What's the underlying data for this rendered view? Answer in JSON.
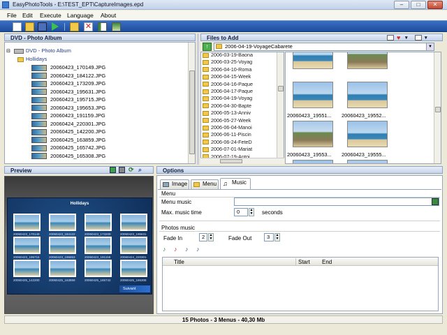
{
  "window": {
    "title": "EasyPhotoTools - E:\\TEST_EPT\\CaptureImages.epd",
    "min": "–",
    "max": "□",
    "close": "✕"
  },
  "menu": [
    "File",
    "Edit",
    "Execute",
    "Language",
    "About"
  ],
  "toolbar": {
    "icons": [
      "new-icon",
      "open-icon",
      "save-icon",
      "run-icon",
      "export-icon",
      "delete-icon",
      "sort-icon",
      "tree-icon"
    ]
  },
  "album_panel": {
    "header": "DVD - Photo Album",
    "root": "DVD - Photo Album",
    "folder": "Hollidays",
    "files": [
      "20060423_170149.JPG",
      "20060423_184122.JPG",
      "20060423_173209.JPG",
      "20060423_195631.JPG",
      "20060423_195715.JPG",
      "20060423_195653.JPG",
      "20060423_191159.JPG",
      "20060424_220301.JPG",
      "20060425_142200.JPG",
      "20060425_163859.JPG",
      "20060425_165742.JPG",
      "20060425_165308.JPG"
    ]
  },
  "files_panel": {
    "header": "Files to Add",
    "combo_value": "2006-04-19-VoyageCabarete",
    "folders": [
      "2006-03-19-Baona",
      "2006-03-25-Voyag",
      "2006-04-10-Roma",
      "2006-04-15-Week",
      "2006-04-16-Paque",
      "2006-04-17-Paque",
      "2006-04-19-Voyag",
      "2006-04-30-Bapte",
      "2006-05-13-Anniv",
      "2006-05-27-Week",
      "2006-06-04-Manoi",
      "2006-06-11-Piscin",
      "2006-06-24-FeteD",
      "2006-07-01-Mariat",
      "2006-07-19-Antoi"
    ],
    "photos": [
      "",
      "",
      "20060423_19551...",
      "20060423_19552...",
      "20060423_19553...",
      "20060423_19555...",
      "",
      ""
    ]
  },
  "preview": {
    "header": "Preview",
    "menu_title": "Hollidays",
    "next": "Suivant",
    "labels": [
      "20060423_170149",
      "20060423_184122",
      "20060423_173209",
      "20060423_195631",
      "20060423_195715",
      "20060423_195653",
      "20060423_191159",
      "20060424_220301",
      "20060425_142200",
      "20060425_163859",
      "20060425_165742",
      "20060425_165308"
    ]
  },
  "options": {
    "header": "Options",
    "tabs": [
      "Image",
      "Menu",
      "Music"
    ],
    "menu_group": "Menu",
    "menu_music_label": "Menu music",
    "menu_music_value": "",
    "max_time_label": "Max. music time",
    "max_time_value": "0",
    "seconds": "seconds",
    "photos_group": "Photos music",
    "fade_in_label": "Fade In",
    "fade_in_value": "2",
    "fade_out_label": "Fade Out",
    "fade_out_value": "3",
    "table_headers": [
      "Title",
      "Start",
      "End"
    ]
  },
  "status": "15 Photos - 3 Menus - 40,30 Mb",
  "colors": {
    "toolbar": "#1e4d9c",
    "header": "#c4d2ea",
    "accent": "#3d7bd1"
  }
}
